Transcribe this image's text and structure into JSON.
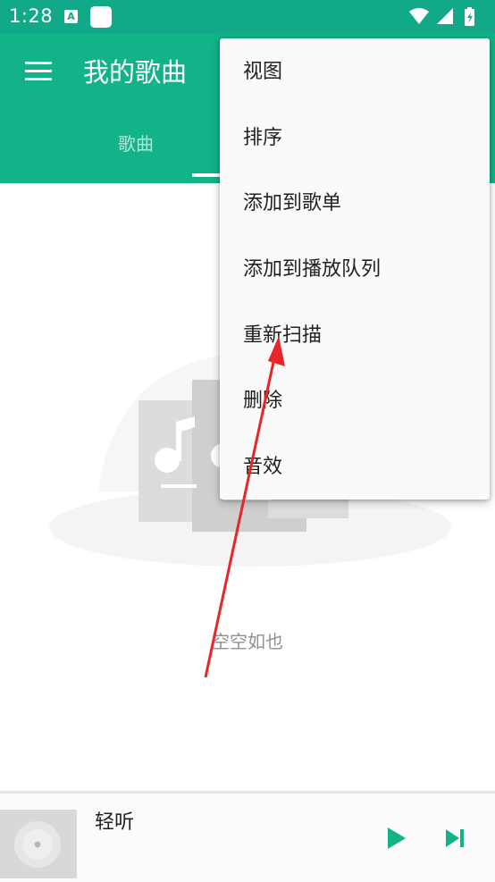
{
  "status_bar": {
    "time": "1:28",
    "notification_letter": "A"
  },
  "app_bar": {
    "title": "我的歌曲",
    "tabs": [
      {
        "label": "歌曲"
      }
    ]
  },
  "empty_state": {
    "text": "空空如也"
  },
  "overflow_menu": {
    "items": [
      {
        "label": "视图"
      },
      {
        "label": "排序"
      },
      {
        "label": "添加到歌单"
      },
      {
        "label": "添加到播放队列"
      },
      {
        "label": "重新扫描"
      },
      {
        "label": "删除"
      },
      {
        "label": "音效"
      }
    ]
  },
  "player": {
    "track_name": "轻听"
  },
  "colors": {
    "primary": "#12b389",
    "status_bar": "#12a988",
    "accent": "#12b389",
    "annotation_arrow": "#e8262a"
  },
  "icons": {
    "hamburger": "menu-icon",
    "play": "play-icon",
    "next": "skip-next-icon",
    "wifi": "wifi-icon",
    "signal": "signal-icon",
    "battery": "battery-icon"
  }
}
